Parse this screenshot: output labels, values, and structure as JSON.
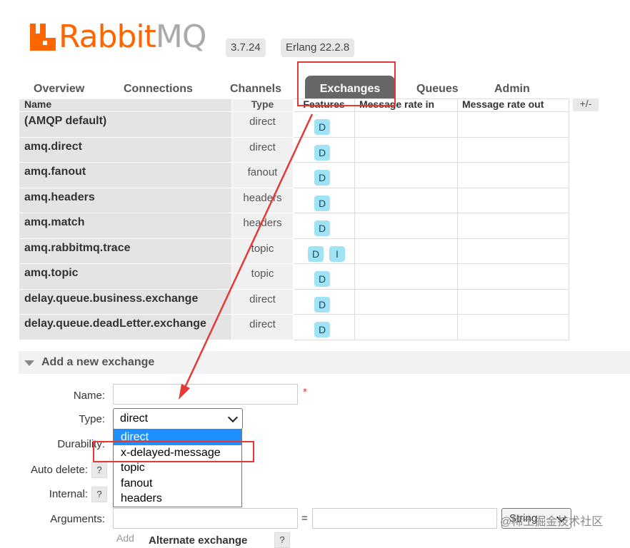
{
  "header": {
    "logo_rabbit": "Rabbit",
    "logo_mq": "MQ",
    "version": "3.7.24",
    "erlang": "Erlang 22.2.8"
  },
  "tabs": [
    {
      "label": "Overview"
    },
    {
      "label": "Connections"
    },
    {
      "label": "Channels"
    },
    {
      "label": "Exchanges",
      "active": true
    },
    {
      "label": "Queues"
    },
    {
      "label": "Admin"
    }
  ],
  "table": {
    "headers": [
      "Name",
      "Type",
      "Features",
      "Message rate in",
      "Message rate out"
    ],
    "plus_minus": "+/-",
    "rows": [
      {
        "name": "(AMQP default)",
        "type": "direct",
        "features": [
          "D"
        ]
      },
      {
        "name": "amq.direct",
        "type": "direct",
        "features": [
          "D"
        ]
      },
      {
        "name": "amq.fanout",
        "type": "fanout",
        "features": [
          "D"
        ]
      },
      {
        "name": "amq.headers",
        "type": "headers",
        "features": [
          "D"
        ]
      },
      {
        "name": "amq.match",
        "type": "headers",
        "features": [
          "D"
        ]
      },
      {
        "name": "amq.rabbitmq.trace",
        "type": "topic",
        "features": [
          "D",
          "I"
        ]
      },
      {
        "name": "amq.topic",
        "type": "topic",
        "features": [
          "D"
        ]
      },
      {
        "name": "delay.queue.business.exchange",
        "type": "direct",
        "features": [
          "D"
        ]
      },
      {
        "name": "delay.queue.deadLetter.exchange",
        "type": "direct",
        "features": [
          "D"
        ]
      }
    ]
  },
  "add_exchange": {
    "title": "Add a new exchange",
    "name_label": "Name:",
    "required_mark": "*",
    "type_label": "Type:",
    "type_value": "direct",
    "type_options": [
      "direct",
      "x-delayed-message",
      "topic",
      "fanout",
      "headers"
    ],
    "durability_label": "Durability:",
    "auto_delete_label": "Auto delete:",
    "internal_label": "Internal:",
    "help_mark": "?",
    "arguments_label": "Arguments:",
    "equals": "=",
    "string_option": "String",
    "add_label": "Add",
    "alternate_exchange": "Alternate exchange"
  },
  "watermark": "@稀土掘金技术社区",
  "colors": {
    "brand": "#ff6600",
    "annotation": "#e53935",
    "feature_pill": "#9fe3f5",
    "selected_option": "#1e90ff"
  }
}
